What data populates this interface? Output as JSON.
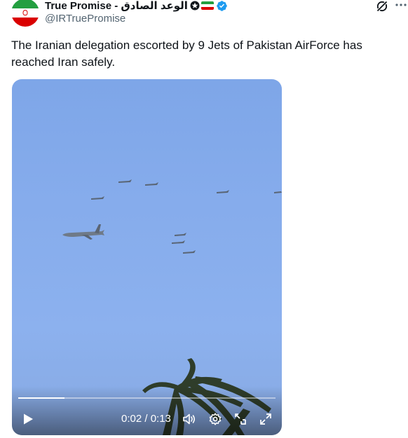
{
  "author": {
    "display_name": "True Promise - الوعد الصادق",
    "handle": "@IRTruePromise",
    "verified": true,
    "avatar_icon": "iran-flag-avatar",
    "badge_icons": [
      "khomeini-star-icon",
      "iran-flag-icon"
    ]
  },
  "header_actions": {
    "grok_icon": "grok-icon",
    "more_icon": "more-icon"
  },
  "tweet": {
    "text": "The Iranian delegation escorted by 9 Jets of Pakistan AirForce has reached Iran safely."
  },
  "video": {
    "time_display": "0:02 / 0:13",
    "progress": 0.18,
    "controls": [
      "play-icon",
      "volume-icon",
      "settings-icon",
      "pip-icon",
      "fullscreen-icon"
    ]
  },
  "colors": {
    "verified_blue": "#1d9bf0",
    "text_primary": "#0f1419",
    "text_secondary": "#536471",
    "sky": "#86acec"
  }
}
